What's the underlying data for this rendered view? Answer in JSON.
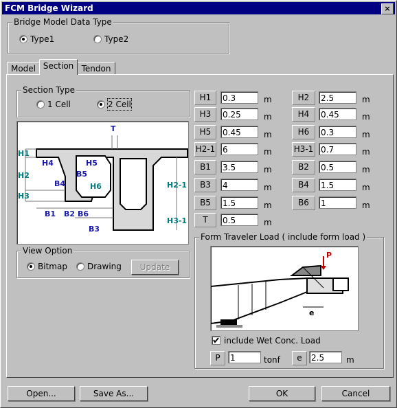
{
  "window": {
    "title": "FCM Bridge Wizard",
    "close_symbol": "×"
  },
  "model_type": {
    "legend": "Bridge Model Data Type",
    "options": [
      "Type1",
      "Type2"
    ],
    "selected": "Type1"
  },
  "tabs": [
    "Model",
    "Section",
    "Tendon"
  ],
  "active_tab": "Section",
  "section_type": {
    "legend": "Section Type",
    "options": [
      "1 Cell",
      "2 Cell"
    ],
    "selected": "2 Cell"
  },
  "diagram_labels": {
    "H1": "H1",
    "H2": "H2",
    "H3": "H3",
    "H4": "H4",
    "H5": "H5",
    "H6": "H6",
    "H2_1": "H2-1",
    "H3_1": "H3-1",
    "B1": "B1",
    "B2": "B2",
    "B3": "B3",
    "B4": "B4",
    "B5": "B5",
    "B6": "B6",
    "T": "T"
  },
  "params_left": [
    {
      "label": "H1",
      "value": "0.3",
      "unit": "m"
    },
    {
      "label": "H3",
      "value": "0.25",
      "unit": "m"
    },
    {
      "label": "H5",
      "value": "0.45",
      "unit": "m"
    },
    {
      "label": "H2-1",
      "value": "6",
      "unit": "m"
    },
    {
      "label": "B1",
      "value": "3.5",
      "unit": "m"
    },
    {
      "label": "B3",
      "value": "4",
      "unit": "m"
    },
    {
      "label": "B5",
      "value": "1.5",
      "unit": "m"
    },
    {
      "label": "T",
      "value": "0.5",
      "unit": "m"
    }
  ],
  "params_right": [
    {
      "label": "H2",
      "value": "2.5",
      "unit": "m"
    },
    {
      "label": "H4",
      "value": "0.45",
      "unit": "m"
    },
    {
      "label": "H6",
      "value": "0.3",
      "unit": "m"
    },
    {
      "label": "H3-1",
      "value": "0.7",
      "unit": "m"
    },
    {
      "label": "B2",
      "value": "0.5",
      "unit": "m"
    },
    {
      "label": "B4",
      "value": "1.5",
      "unit": "m"
    },
    {
      "label": "B6",
      "value": "1",
      "unit": "m"
    }
  ],
  "view_option": {
    "legend": "View Option",
    "options": [
      "Bitmap",
      "Drawing"
    ],
    "selected": "Bitmap",
    "update_label": "Update"
  },
  "form_traveler": {
    "legend": "Form Traveler Load ( include form load )",
    "diagram_P": "P",
    "diagram_e": "e",
    "checkbox_label": "include Wet Conc. Load",
    "checked": true,
    "P_label": "P",
    "P_value": "1",
    "P_unit": "tonf",
    "e_label": "e",
    "e_value": "2.5",
    "e_unit": "m"
  },
  "buttons": {
    "open": "Open...",
    "save_as": "Save As...",
    "ok": "OK",
    "cancel": "Cancel"
  },
  "colors": {
    "titlebar": "#000080",
    "face": "#c0c0c0",
    "label_blue": "#1a1aa6",
    "label_teal": "#007a7a"
  }
}
